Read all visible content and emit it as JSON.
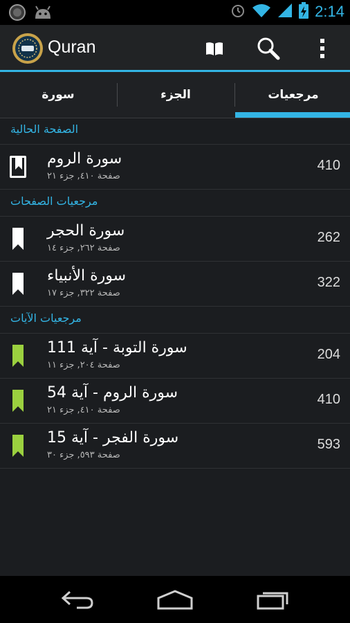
{
  "status_bar": {
    "time": "2:14",
    "left_icons": [
      "quran-notification-icon",
      "android-debug-icon"
    ],
    "right_icons": [
      "alarm-icon",
      "wifi-icon",
      "signal-icon",
      "battery-charging-icon"
    ]
  },
  "action_bar": {
    "title": "Quran",
    "actions": [
      "book-icon",
      "search-icon",
      "overflow-menu-icon"
    ]
  },
  "tabs": [
    {
      "label": "سورة",
      "selected": false
    },
    {
      "label": "الجزء",
      "selected": false
    },
    {
      "label": "مرجعيات",
      "selected": true
    }
  ],
  "sections": [
    {
      "header": "الصفحة الحالية",
      "items": [
        {
          "title": "سورة الروم",
          "meta": "صفحة ٤١٠, جزء ٢١",
          "page": "410",
          "icon": "current-page-bookmark-icon"
        }
      ]
    },
    {
      "header": "مرجعيات الصفحات",
      "items": [
        {
          "title": "سورة الحجر",
          "meta": "صفحة ٢٦٢, جزء ١٤",
          "page": "262",
          "icon": "page-bookmark-icon"
        },
        {
          "title": "سورة الأنبياء",
          "meta": "صفحة ٣٢٢, جزء ١٧",
          "page": "322",
          "icon": "page-bookmark-icon"
        }
      ]
    },
    {
      "header": "مرجعيات الآيات",
      "items": [
        {
          "title": "سورة التوبة - آية 111",
          "meta": "صفحة ٢٠٤, جزء ١١",
          "page": "204",
          "icon": "ayah-bookmark-icon"
        },
        {
          "title": "سورة الروم - آية 54",
          "meta": "صفحة ٤١٠, جزء ٢١",
          "page": "410",
          "icon": "ayah-bookmark-icon"
        },
        {
          "title": "سورة الفجر - آية 15",
          "meta": "صفحة ٥٩٣, جزء ٣٠",
          "page": "593",
          "icon": "ayah-bookmark-icon"
        }
      ]
    }
  ],
  "colors": {
    "accent": "#33b5e5",
    "ayah_bookmark": "#9bd03f",
    "page_bookmark": "#ffffff",
    "background": "#1b1d20"
  },
  "nav_bar": [
    "back-icon",
    "home-icon",
    "recent-apps-icon"
  ]
}
